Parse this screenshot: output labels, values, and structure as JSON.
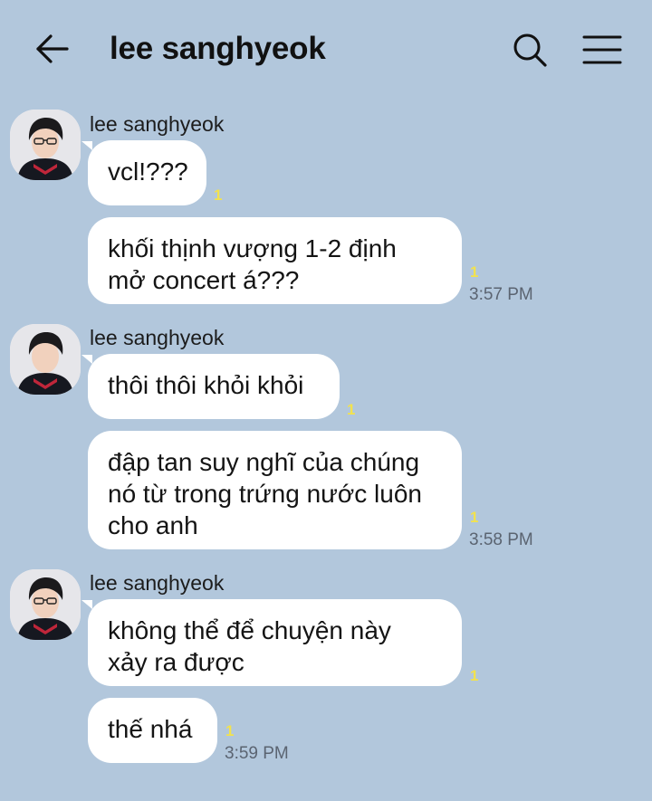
{
  "header": {
    "title": "lee sanghyeok",
    "back_icon": "arrow-left-icon",
    "search_icon": "search-icon",
    "menu_icon": "hamburger-menu-icon"
  },
  "colors": {
    "background": "#b2c7dc",
    "bubble": "#ffffff",
    "unread": "#f2e24e",
    "time": "#5b6471"
  },
  "messages": [
    {
      "sender": "lee sanghyeok",
      "bubbles": [
        {
          "lines": [
            "vcl!???"
          ],
          "unread": "1",
          "time": ""
        },
        {
          "lines": [
            "khối thịnh vượng 1-2 định",
            "mở concert á???"
          ],
          "unread": "1",
          "time": "3:57 PM"
        }
      ]
    },
    {
      "sender": "lee sanghyeok",
      "bubbles": [
        {
          "lines": [
            "thôi thôi khỏi khỏi"
          ],
          "unread": "1",
          "time": ""
        },
        {
          "lines": [
            "đập tan suy nghĩ của chúng",
            "nó từ trong trứng nước luôn",
            "cho anh"
          ],
          "unread": "1",
          "time": "3:58 PM"
        }
      ]
    },
    {
      "sender": "lee sanghyeok",
      "bubbles": [
        {
          "lines": [
            "không thể để chuyện này",
            "xảy ra được"
          ],
          "unread": "1",
          "time": ""
        },
        {
          "lines": [
            "thế nhá"
          ],
          "unread": "1",
          "time": "3:59 PM"
        }
      ]
    }
  ]
}
